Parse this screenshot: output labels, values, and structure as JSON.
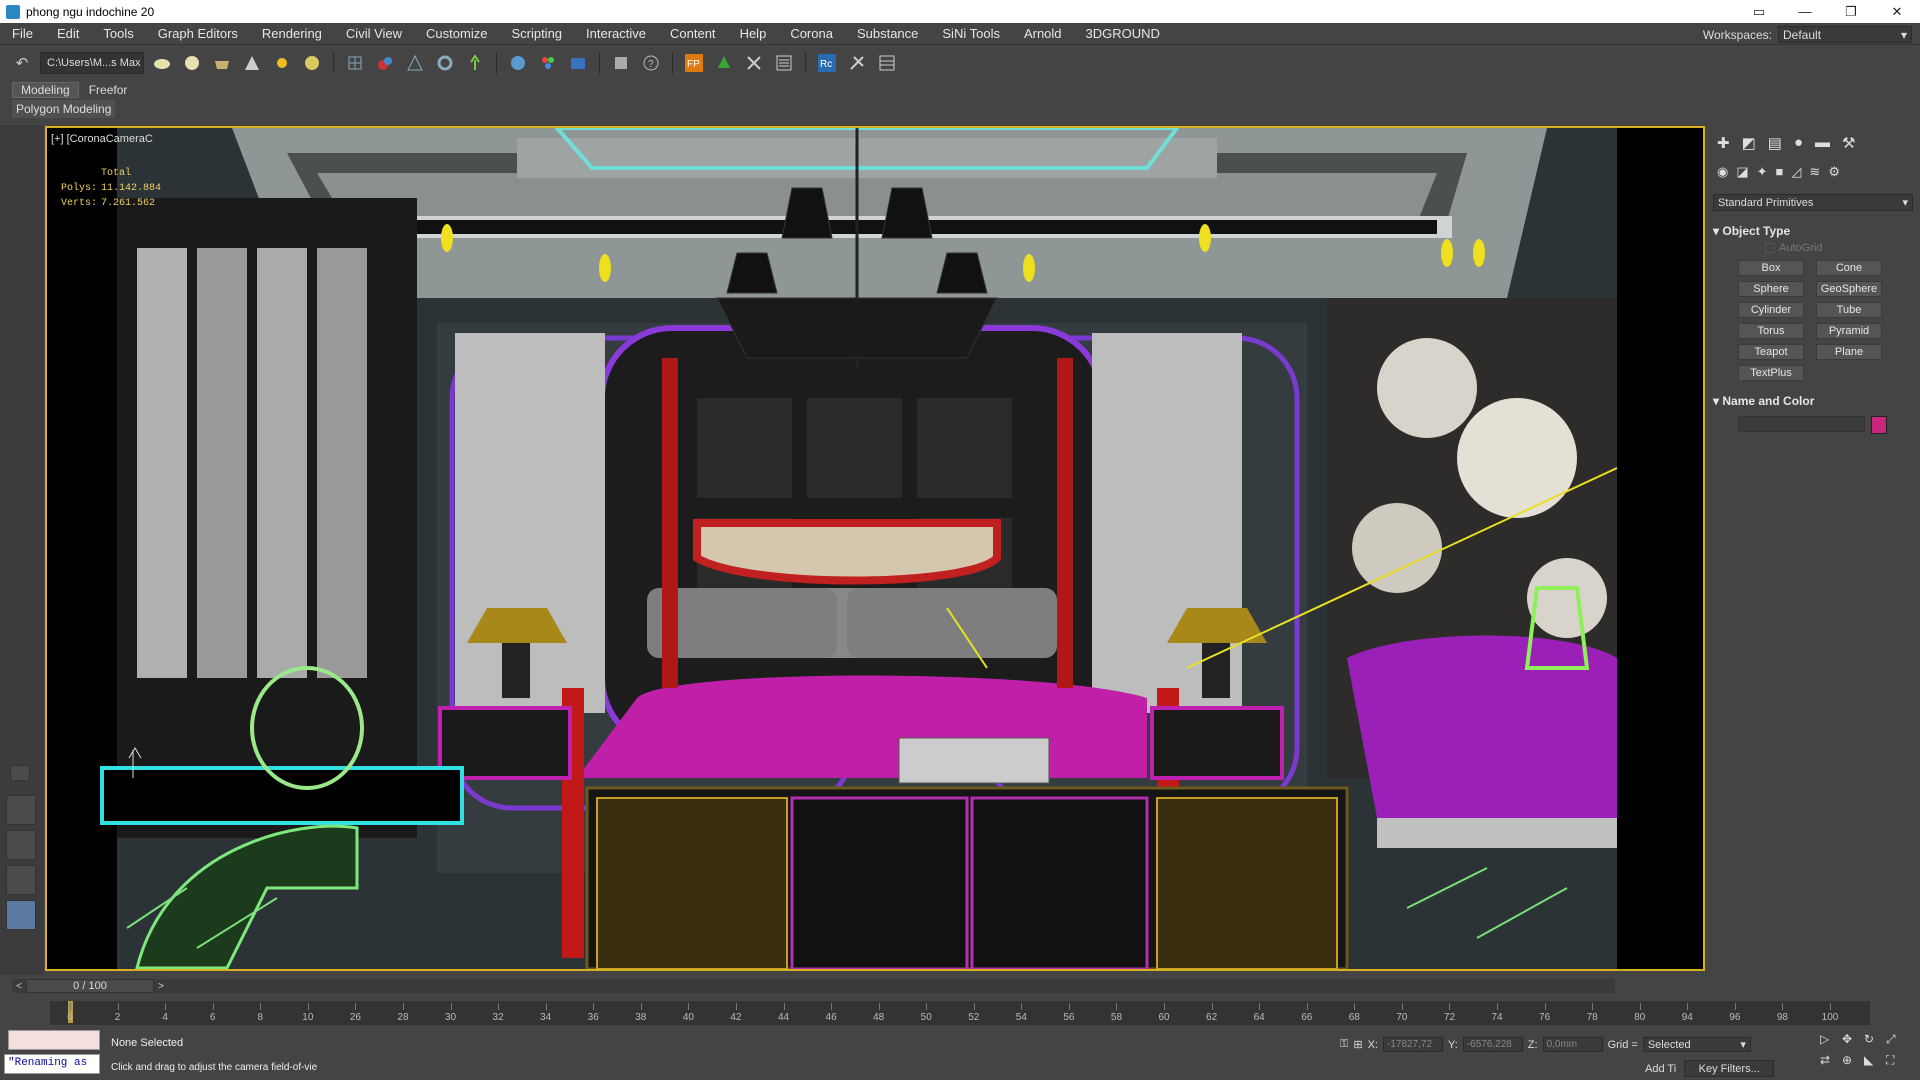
{
  "window": {
    "title": "phong ngu indochine 20",
    "controls": [
      "▭",
      "—",
      "❐",
      "✕"
    ]
  },
  "menu": [
    "File",
    "Edit",
    "Tools",
    "Graph Editors",
    "Rendering",
    "Civil View",
    "Customize",
    "Scripting",
    "Interactive",
    "Content",
    "Help",
    "Corona",
    "Substance",
    "SiNi Tools",
    "Arnold",
    "3DGROUND"
  ],
  "workspace": {
    "label": "Workspaces:",
    "value": "Default"
  },
  "toolbar": {
    "path": "C:\\Users\\M...s Max"
  },
  "ribbon": {
    "tabs": [
      "Modeling",
      "Freefor"
    ],
    "row": "Polygon Modeling"
  },
  "viewport": {
    "label": "[+] [CoronaCameraC",
    "stats": {
      "total": "Total",
      "polys_label": "Polys:",
      "polys": "11.142.884",
      "verts_label": "Verts:",
      "verts": "7.261.562"
    }
  },
  "command_panel": {
    "primitive_type": "Standard Primitives",
    "object_type_title": "Object Type",
    "autogrid": "AutoGrid",
    "buttons": [
      "Box",
      "Cone",
      "Sphere",
      "GeoSphere",
      "Cylinder",
      "Tube",
      "Torus",
      "Pyramid",
      "Teapot",
      "Plane",
      "TextPlus"
    ],
    "name_color_title": "Name and Color",
    "swatch_color": "#c8287c"
  },
  "timeline": {
    "frame": "0 / 100",
    "ticks": [
      "0",
      "2",
      "4",
      "6",
      "8",
      "10",
      "26",
      "28",
      "30",
      "32",
      "34",
      "36",
      "38",
      "40",
      "42",
      "44",
      "46",
      "48",
      "50",
      "52",
      "54",
      "56",
      "58",
      "60",
      "62",
      "64",
      "66",
      "68",
      "70",
      "72",
      "74",
      "76",
      "78",
      "80",
      "94",
      "96",
      "98",
      "100"
    ]
  },
  "status": {
    "listener": "\"Renaming as",
    "selection": "None Selected",
    "prompt": "Click and drag to adjust the camera field-of-vie",
    "x_label": "X:",
    "x": "-17827,72",
    "y_label": "Y:",
    "y": "-6576,228",
    "z_label": "Z:",
    "z": "0,0mm",
    "grid_label": "Grid =",
    "grid_value": "Selected",
    "add_time": "Add Ti",
    "key_filters": "Key Filters..."
  }
}
